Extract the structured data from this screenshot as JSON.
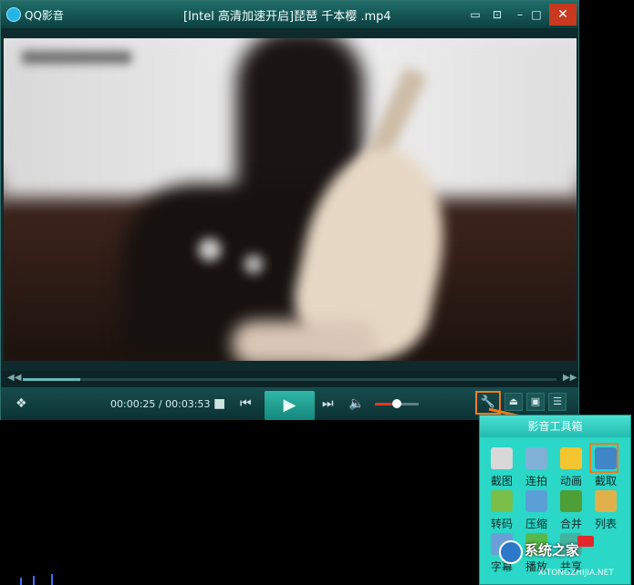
{
  "window": {
    "app_name": "QQ影音",
    "title": "[Intel 高清加速开启]琵琶 千本樱 .mp4",
    "controls": [
      "message-icon",
      "minimize-to-tray-icon",
      "minimize-icon",
      "maximize-icon",
      "close-icon"
    ]
  },
  "player": {
    "time_current": "00:00:25",
    "time_total": "00:03:53",
    "time_separator": " / ",
    "seek_progress": 0.107,
    "volume_level": 0.5
  },
  "toolbox": {
    "title": "影音工具箱",
    "tools": [
      {
        "label": "截图",
        "icon": "camera-icon",
        "color": "#d8d8d8"
      },
      {
        "label": "连拍",
        "icon": "burst-icon",
        "color": "#7fb1d6"
      },
      {
        "label": "动画",
        "icon": "gif-icon",
        "color": "#f2c531"
      },
      {
        "label": "截取",
        "icon": "film-clip-icon",
        "color": "#3f86c8"
      },
      {
        "label": "转码",
        "icon": "convert-icon",
        "color": "#79bf49"
      },
      {
        "label": "压缩",
        "icon": "compress-icon",
        "color": "#5aa0d6"
      },
      {
        "label": "合并",
        "icon": "merge-icon",
        "color": "#4e9f37"
      },
      {
        "label": "列表",
        "icon": "playlist-icon",
        "color": "#e0b14b"
      },
      {
        "label": "字幕",
        "icon": "subtitle-icon",
        "color": "#6a9fd8"
      },
      {
        "label": "播放",
        "icon": "play-icon",
        "color": "#58b84a"
      },
      {
        "label": "共享",
        "icon": "share-icon",
        "color": "#42b3a0"
      }
    ]
  },
  "watermark": {
    "text": "系统之家",
    "subtext": "XITONGZHIJIA.NET"
  }
}
